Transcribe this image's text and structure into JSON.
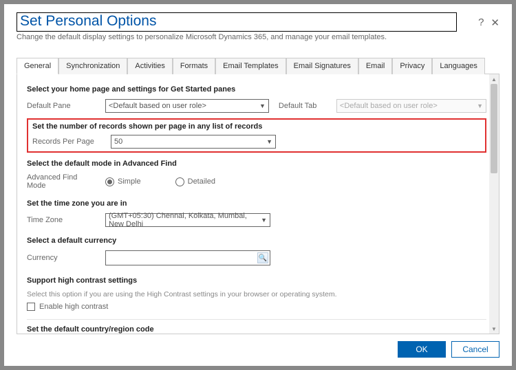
{
  "header": {
    "title": "Set Personal Options",
    "subtitle": "Change the default display settings to personalize Microsoft Dynamics 365, and manage your email templates."
  },
  "tabs": [
    "General",
    "Synchronization",
    "Activities",
    "Formats",
    "Email Templates",
    "Email Signatures",
    "Email",
    "Privacy",
    "Languages"
  ],
  "section1": {
    "title": "Select your home page and settings for Get Started panes",
    "defaultPaneLabel": "Default Pane",
    "defaultPaneValue": "<Default based on user role>",
    "defaultTabLabel": "Default Tab",
    "defaultTabValue": "<Default based on user role>"
  },
  "section2": {
    "title": "Set the number of records shown per page in any list of records",
    "recordsLabel": "Records Per Page",
    "recordsValue": "50"
  },
  "section3": {
    "title": "Select the default mode in Advanced Find",
    "modeLabel": "Advanced Find Mode",
    "simple": "Simple",
    "detailed": "Detailed"
  },
  "section4": {
    "title": "Set the time zone you are in",
    "tzLabel": "Time Zone",
    "tzValue": "(GMT+05:30) Chennai, Kolkata, Mumbai, New Delhi"
  },
  "section5": {
    "title": "Select a default currency",
    "currencyLabel": "Currency"
  },
  "section6": {
    "title": "Support high contrast settings",
    "hint": "Select this option if you are using the High Contrast settings in your browser or operating system.",
    "enable": "Enable high contrast"
  },
  "section7": {
    "title": "Set the default country/region code"
  },
  "footer": {
    "ok": "OK",
    "cancel": "Cancel"
  }
}
